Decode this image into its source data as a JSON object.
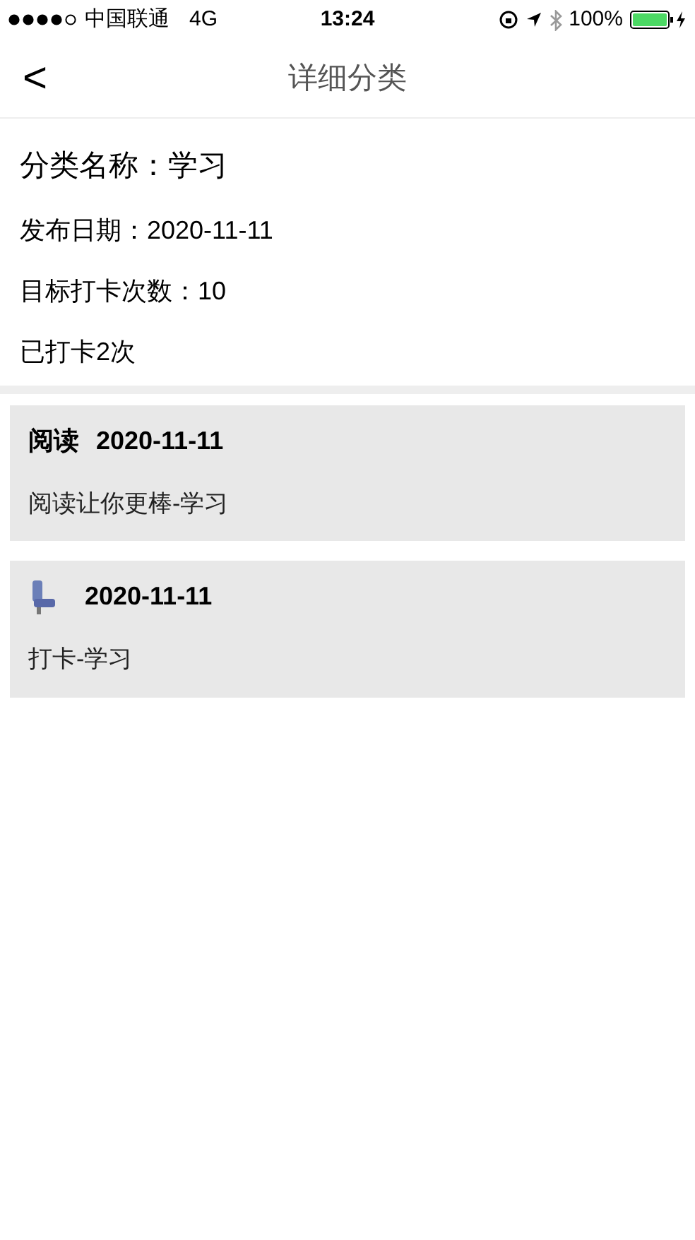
{
  "status_bar": {
    "carrier": "中国联通",
    "network": "4G",
    "time": "13:24",
    "battery": "100%"
  },
  "nav": {
    "back": "<",
    "title": "详细分类"
  },
  "info": {
    "name": "分类名称：学习",
    "date": "发布日期：2020-11-11",
    "target": "目标打卡次数：10",
    "done": "已打卡2次"
  },
  "records": [
    {
      "kind": "text",
      "title": "阅读",
      "date": "2020-11-11",
      "body": "阅读让你更棒-学习"
    },
    {
      "kind": "icon",
      "date": "2020-11-11",
      "body": "打卡-学习"
    }
  ]
}
